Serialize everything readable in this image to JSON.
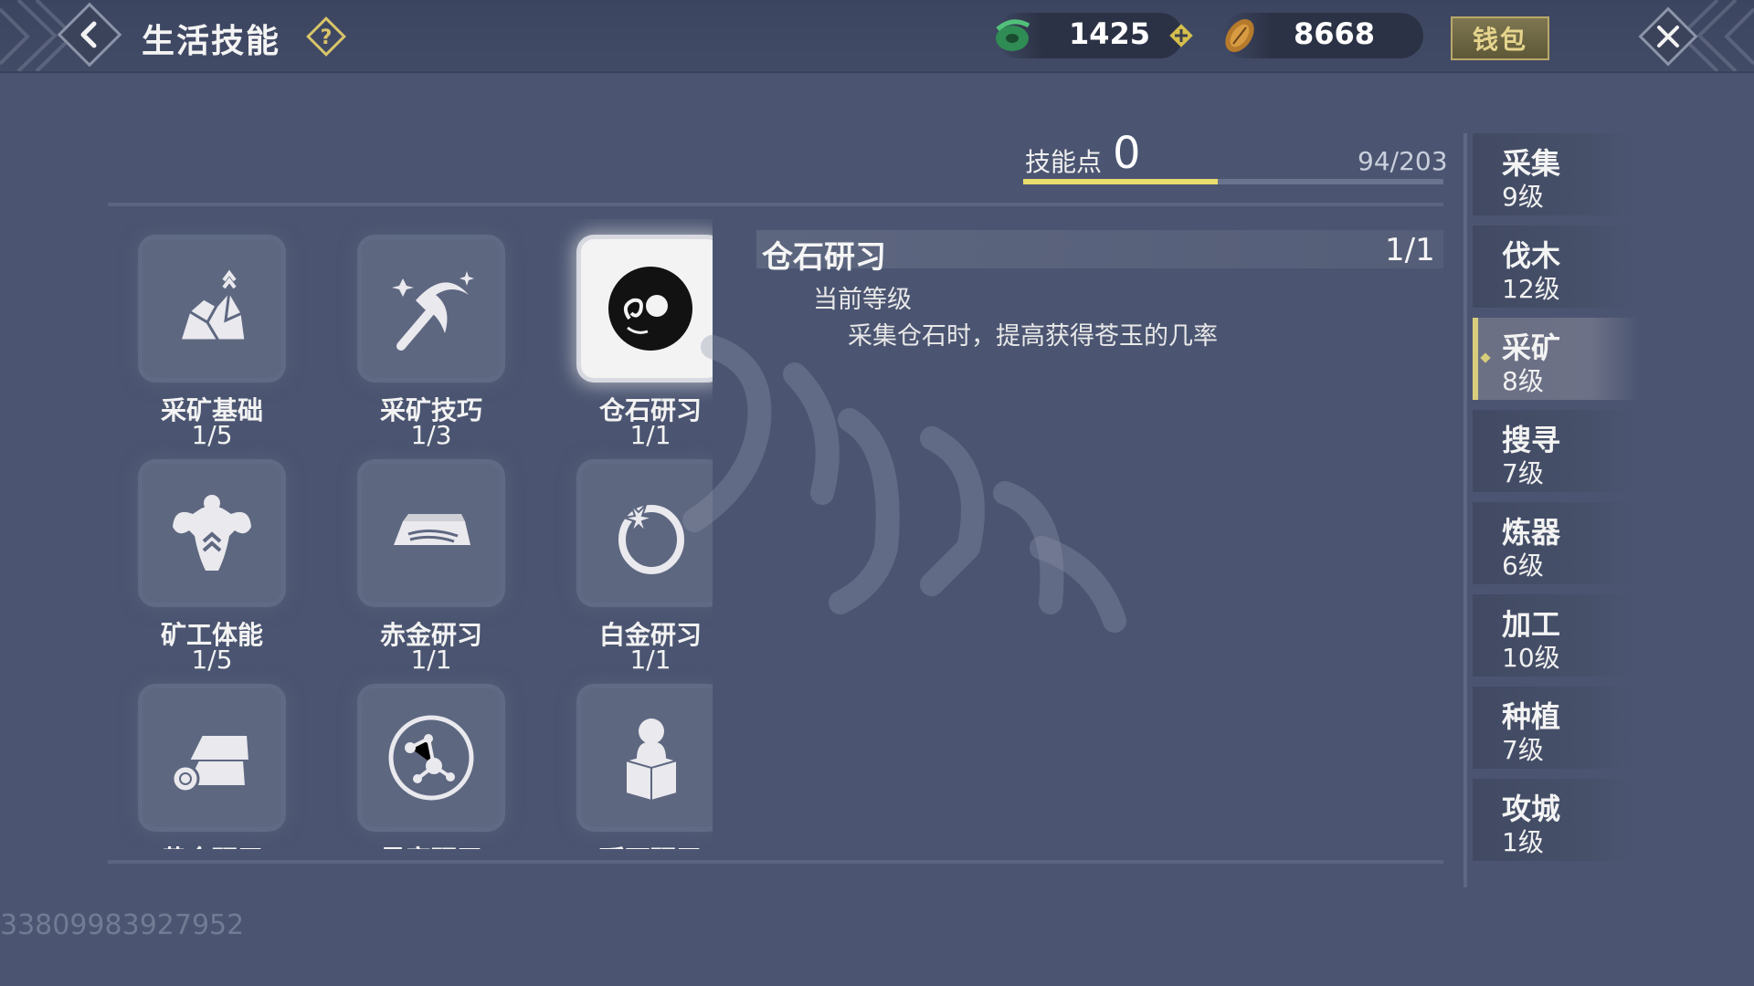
{
  "header": {
    "title": "生活技能",
    "currency_1": {
      "icon": "jade-icon",
      "value": "1425"
    },
    "currency_2": {
      "icon": "coin-icon",
      "value": "8668"
    },
    "wallet_label": "钱包"
  },
  "skill_points": {
    "label": "技能点",
    "value": "0",
    "progress_text": "94/203",
    "progress_fraction": 0.463
  },
  "skills": [
    {
      "name": "采矿基础",
      "level": "1/5",
      "icon": "ore-icon",
      "selected": false
    },
    {
      "name": "采矿技巧",
      "level": "1/3",
      "icon": "pickaxe-icon",
      "selected": false
    },
    {
      "name": "仓石研习",
      "level": "1/1",
      "icon": "jade-disc-icon",
      "selected": true
    },
    {
      "name": "矿工体能",
      "level": "1/5",
      "icon": "muscle-icon",
      "selected": false
    },
    {
      "name": "赤金研习",
      "level": "1/1",
      "icon": "gold-bar-icon",
      "selected": false
    },
    {
      "name": "白金研习",
      "level": "1/1",
      "icon": "ring-icon",
      "selected": false
    },
    {
      "name": "黄金研习",
      "level": "",
      "icon": "gold-ingots-icon",
      "selected": false
    },
    {
      "name": "星宿研习",
      "level": "",
      "icon": "constellation-icon",
      "selected": false
    },
    {
      "name": "瑶石研习",
      "level": "",
      "icon": "seal-stone-icon",
      "selected": false
    }
  ],
  "detail": {
    "title": "仓石研习",
    "level": "1/1",
    "current_level_label": "当前等级",
    "description": "采集仓石时，提高获得苍玉的几率"
  },
  "tabs": [
    {
      "name": "采集",
      "level": "9级",
      "active": false
    },
    {
      "name": "伐木",
      "level": "12级",
      "active": false
    },
    {
      "name": "采矿",
      "level": "8级",
      "active": true
    },
    {
      "name": "搜寻",
      "level": "7级",
      "active": false
    },
    {
      "name": "炼器",
      "level": "6级",
      "active": false
    },
    {
      "name": "加工",
      "level": "10级",
      "active": false
    },
    {
      "name": "种植",
      "level": "7级",
      "active": false
    },
    {
      "name": "攻城",
      "level": "1级",
      "active": false
    }
  ],
  "footer_id": "33809983927952",
  "colors": {
    "accent": "#e9dc6e",
    "background": "#4b5571",
    "wallet_text": "#e5d48c"
  }
}
